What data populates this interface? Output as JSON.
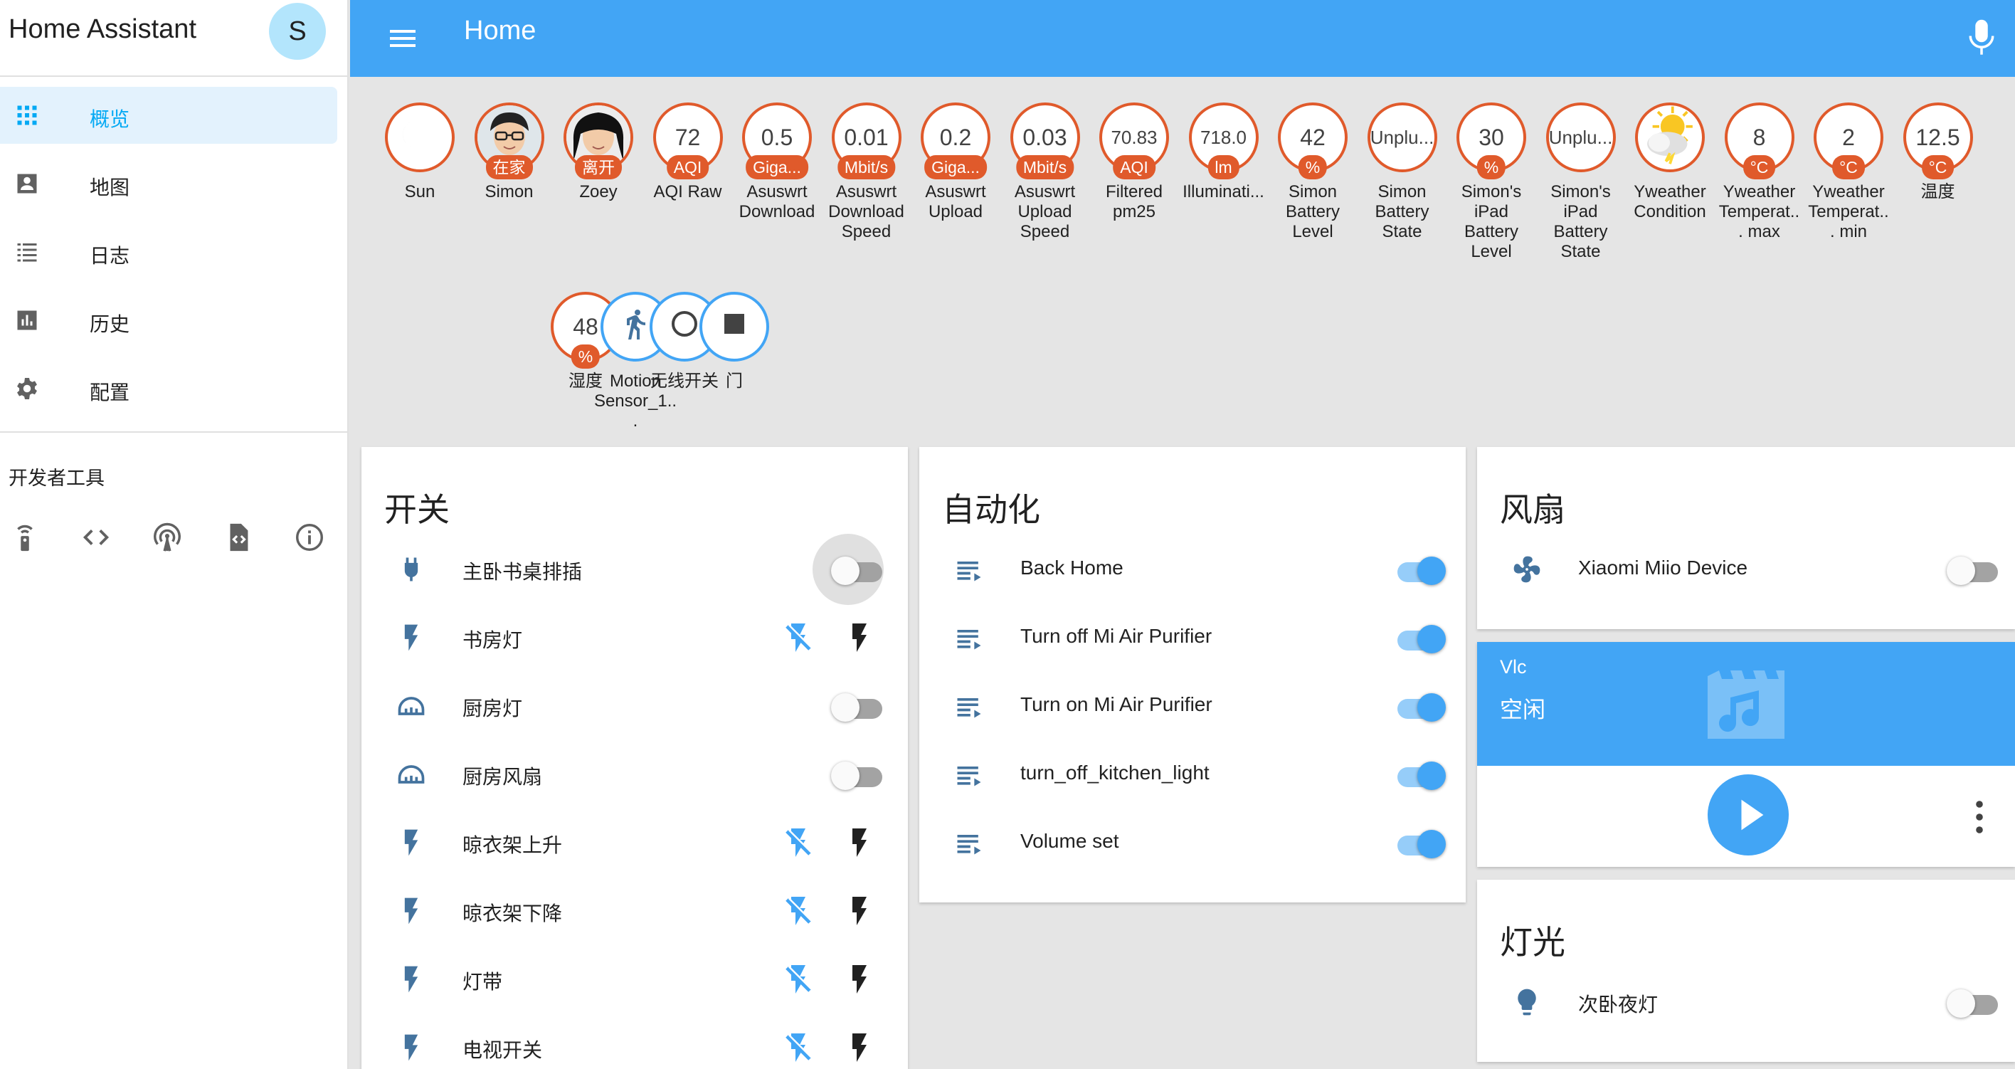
{
  "app_title": "Home Assistant",
  "user_initial": "S",
  "header": {
    "title": "Home"
  },
  "sidebar": {
    "items": [
      {
        "label": "概览",
        "icon": "grid-icon",
        "active": true
      },
      {
        "label": "地图",
        "icon": "account-box-icon",
        "active": false
      },
      {
        "label": "日志",
        "icon": "list-icon",
        "active": false
      },
      {
        "label": "历史",
        "icon": "chart-icon",
        "active": false
      },
      {
        "label": "配置",
        "icon": "gear-icon",
        "active": false
      }
    ],
    "dev_tools_title": "开发者工具",
    "dev_tools": [
      "remote-icon",
      "code-icon",
      "radio-tower-icon",
      "file-code-icon",
      "info-icon"
    ]
  },
  "badges": [
    {
      "value": "",
      "unit": "",
      "name": "Sun",
      "icon": "moon-icon"
    },
    {
      "value": "",
      "unit": "在家",
      "name": "Simon",
      "icon": "person-photo"
    },
    {
      "value": "",
      "unit": "离开",
      "name": "Zoey",
      "icon": "person-photo"
    },
    {
      "value": "72",
      "unit": "AQI",
      "name": "AQI Raw"
    },
    {
      "value": "0.5",
      "unit": "Giga...",
      "name": "Asuswrt Download"
    },
    {
      "value": "0.01",
      "unit": "Mbit/s",
      "name": "Asuswrt Download Speed"
    },
    {
      "value": "0.2",
      "unit": "Giga...",
      "name": "Asuswrt Upload"
    },
    {
      "value": "0.03",
      "unit": "Mbit/s",
      "name": "Asuswrt Upload Speed"
    },
    {
      "value": "70.83",
      "unit": "AQI",
      "name": "Filtered pm25"
    },
    {
      "value": "718.0",
      "unit": "lm",
      "name": "Illuminati..."
    },
    {
      "value": "42",
      "unit": "%",
      "name": "Simon Battery Level"
    },
    {
      "value": "Unplu...",
      "unit": "",
      "name": "Simon Battery State"
    },
    {
      "value": "30",
      "unit": "%",
      "name": "Simon's iPad Battery Level"
    },
    {
      "value": "Unplu...",
      "unit": "",
      "name": "Simon's iPad Battery State"
    },
    {
      "value": "",
      "unit": "",
      "name": "Yweather Condition",
      "icon": "weather-icon"
    },
    {
      "value": "8",
      "unit": "°C",
      "name": "Yweather Temperat... max"
    },
    {
      "value": "2",
      "unit": "°C",
      "name": "Yweather Temperat... min"
    },
    {
      "value": "12.5",
      "unit": "°C",
      "name": "温度"
    },
    {
      "value": "48",
      "unit": "%",
      "name": "湿度"
    },
    {
      "value": "",
      "unit": "",
      "name": "Motion Sensor_1...",
      "icon": "walk-icon"
    },
    {
      "value": "",
      "unit": "",
      "name": "无线开关",
      "icon": "circle-outline-icon"
    },
    {
      "value": "",
      "unit": "",
      "name": "门",
      "icon": "square-icon"
    }
  ],
  "switches": {
    "title": "开关",
    "rows": [
      {
        "label": "主卧书桌排插",
        "icon": "plug-icon",
        "control": "toggle",
        "on": false
      },
      {
        "label": "书房灯",
        "icon": "flash-icon",
        "control": "buttons"
      },
      {
        "label": "厨房灯",
        "icon": "meter-icon",
        "control": "toggle",
        "on": false
      },
      {
        "label": "厨房风扇",
        "icon": "meter-icon",
        "control": "toggle",
        "on": false
      },
      {
        "label": "晾衣架上升",
        "icon": "flash-icon",
        "control": "buttons"
      },
      {
        "label": "晾衣架下降",
        "icon": "flash-icon",
        "control": "buttons"
      },
      {
        "label": "灯带",
        "icon": "flash-icon",
        "control": "buttons"
      },
      {
        "label": "电视开关",
        "icon": "flash-icon",
        "control": "buttons"
      }
    ]
  },
  "automation": {
    "title": "自动化",
    "rows": [
      {
        "label": "Back Home",
        "on": true
      },
      {
        "label": "Turn off Mi Air Purifier",
        "on": true
      },
      {
        "label": "Turn on Mi Air Purifier",
        "on": true
      },
      {
        "label": "turn_off_kitchen_light",
        "on": true
      },
      {
        "label": "Volume set",
        "on": true
      }
    ]
  },
  "fan": {
    "title": "风扇",
    "rows": [
      {
        "label": "Xiaomi Miio Device",
        "on": false
      }
    ]
  },
  "media": {
    "name": "Vlc",
    "state": "空闲"
  },
  "lights": {
    "title": "灯光",
    "rows": [
      {
        "label": "次卧夜灯",
        "on": false
      }
    ]
  },
  "colors": {
    "accent": "#42a5f5",
    "badge_border": "#e05a2b",
    "icon": "#44739e",
    "background": "#e5e5e5"
  }
}
